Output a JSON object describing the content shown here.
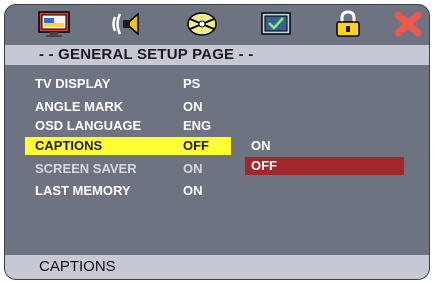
{
  "colors": {
    "panel": "#6e7382",
    "bar": "#c6c9d3",
    "highlight": "#ffff33",
    "option_highlight": "#a3262b"
  },
  "iconbar": {
    "icons": [
      "tv-display-icon",
      "audio-icon",
      "video-disc-icon",
      "preference-icon",
      "password-lock-icon",
      "exit-icon"
    ]
  },
  "header": {
    "title": "- - GENERAL SETUP PAGE - -"
  },
  "menu": {
    "items": [
      {
        "label": "TV DISPLAY",
        "value": "PS"
      },
      {
        "label": "ANGLE MARK",
        "value": "ON"
      },
      {
        "label": "OSD LANGUAGE",
        "value": "ENG"
      },
      {
        "label": "CAPTIONS",
        "value": "OFF",
        "selected": true
      },
      {
        "label": "SCREEN SAVER",
        "value": "ON"
      },
      {
        "label": "LAST MEMORY",
        "value": "ON"
      }
    ]
  },
  "options": {
    "items": [
      {
        "label": "ON"
      },
      {
        "label": "OFF",
        "selected": true
      }
    ]
  },
  "footer": {
    "text": "CAPTIONS"
  }
}
